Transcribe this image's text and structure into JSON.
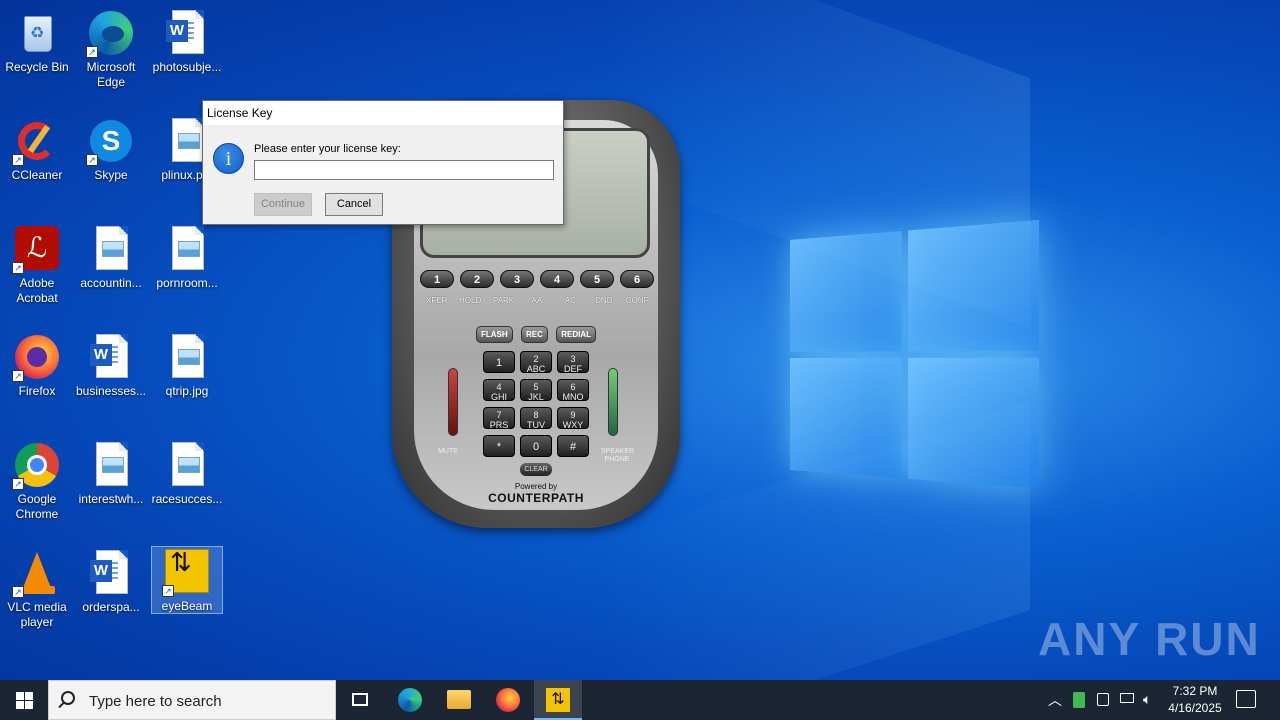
{
  "desktop_icons": [
    {
      "label": "Recycle Bin"
    },
    {
      "label": "Microsoft Edge"
    },
    {
      "label": "photosubje..."
    },
    {
      "label": "CCleaner"
    },
    {
      "label": "Skype"
    },
    {
      "label": "plinux.p..."
    },
    {
      "label": "Adobe Acrobat"
    },
    {
      "label": "accountin..."
    },
    {
      "label": "pornroom..."
    },
    {
      "label": "Firefox"
    },
    {
      "label": "businesses..."
    },
    {
      "label": "qtrip.jpg"
    },
    {
      "label": "Google Chrome"
    },
    {
      "label": "interestwh..."
    },
    {
      "label": "racesucces..."
    },
    {
      "label": "VLC media player"
    },
    {
      "label": "orderspa..."
    },
    {
      "label": "eyeBeam"
    }
  ],
  "dialog": {
    "title": "License Key",
    "prompt": "Please enter your license key:",
    "input_value": "",
    "continue_label": "Continue",
    "cancel_label": "Cancel"
  },
  "phone": {
    "line_buttons": [
      "1",
      "2",
      "3",
      "4",
      "5",
      "6"
    ],
    "function_labels": [
      "XFER",
      "HOLD",
      "PARK",
      "AA",
      "AC",
      "DND",
      "CONF"
    ],
    "top_keys": [
      "FLASH",
      "REC",
      "REDIAL"
    ],
    "keys": [
      {
        "main": "1",
        "sub": ""
      },
      {
        "main": "2",
        "sub": "ABC"
      },
      {
        "main": "3",
        "sub": "DEF"
      },
      {
        "main": "4",
        "sub": "GHI"
      },
      {
        "main": "5",
        "sub": "JKL"
      },
      {
        "main": "6",
        "sub": "MNO"
      },
      {
        "main": "7",
        "sub": "PRS"
      },
      {
        "main": "8",
        "sub": "TUV"
      },
      {
        "main": "9",
        "sub": "WXY"
      },
      {
        "main": "*",
        "sub": ""
      },
      {
        "main": "0",
        "sub": ""
      },
      {
        "main": "#",
        "sub": ""
      }
    ],
    "clear_label": "CLEAR",
    "mute_label": "MUTE",
    "speaker_label": "SPEAKER PHONE",
    "powered_by": "Powered by",
    "brand": "COUNTERPATH"
  },
  "watermark": "ANY RUN",
  "taskbar": {
    "search_placeholder": "Type here to search",
    "time": "7:32 PM",
    "date": "4/16/2025"
  },
  "colors": {
    "desktop_blue": "#0a5fd1",
    "taskbar": "#1c2533",
    "accent": "#76b9ed"
  }
}
